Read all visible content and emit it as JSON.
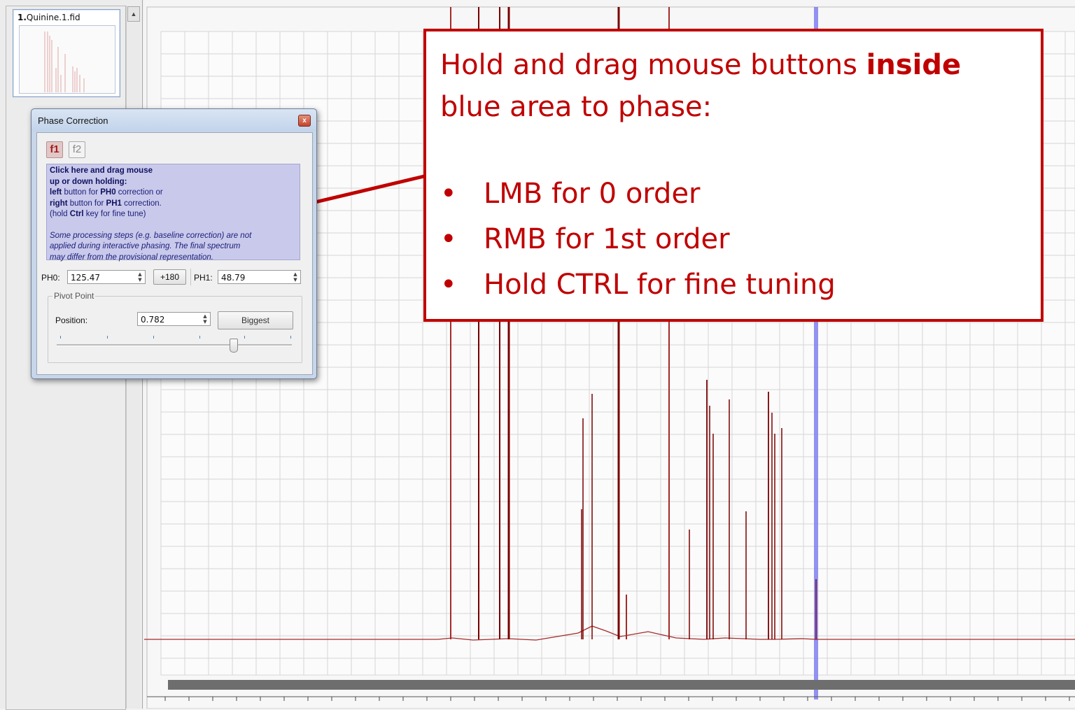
{
  "thumbnail": {
    "index": "1.",
    "name": "Quinine.1.fid"
  },
  "dialog": {
    "title": "Phase Correction",
    "close_label": "x",
    "tabs": [
      "f1",
      "f2"
    ],
    "hotspot": {
      "bold_line1": "Click here and drag mouse",
      "bold_line2": "up or down holding:",
      "line3_b1": "left",
      "line3_t1": " button for ",
      "line3_b2": "PH0",
      "line3_t2": " correction or",
      "line4_b1": "right",
      "line4_t1": " button for ",
      "line4_b2": "PH1",
      "line4_t2": " correction.",
      "line5_t1": "(hold ",
      "line5_b1": "Ctrl",
      "line5_t2": " key for fine tune)",
      "note_line1": "Some processing steps (e.g. baseline correction) are not",
      "note_line2": "applied during interactive phasing. The final spectrum",
      "note_line3": "may differ from the provisional representation."
    },
    "ph0_label": "PH0:",
    "ph0_value": "125.47",
    "plus180_label": "+180",
    "ph1_label": "PH1:",
    "ph1_value": "48.79",
    "pivot_legend": "Pivot Point",
    "position_label": "Position:",
    "position_value": "0.782",
    "biggest_label": "Biggest",
    "slider_level": 0.75
  },
  "callout": {
    "heading_part1": "Hold and drag mouse buttons ",
    "heading_bold": "inside",
    "heading_part2": " blue area to phase:",
    "bullet_symbol": "•",
    "bullets": [
      "LMB for 0 order",
      "RMB for 1st order",
      "Hold CTRL for fine tuning"
    ]
  },
  "colors": {
    "spectrum_line": "#a52a2a",
    "spectrum_peak": "#7a0000",
    "pivot_line": "#8080f0",
    "callout_red": "#c00000"
  },
  "icons": {
    "scroll_up": "triangle-up-icon",
    "close": "close-icon",
    "spin": "spin-arrows-icon"
  }
}
